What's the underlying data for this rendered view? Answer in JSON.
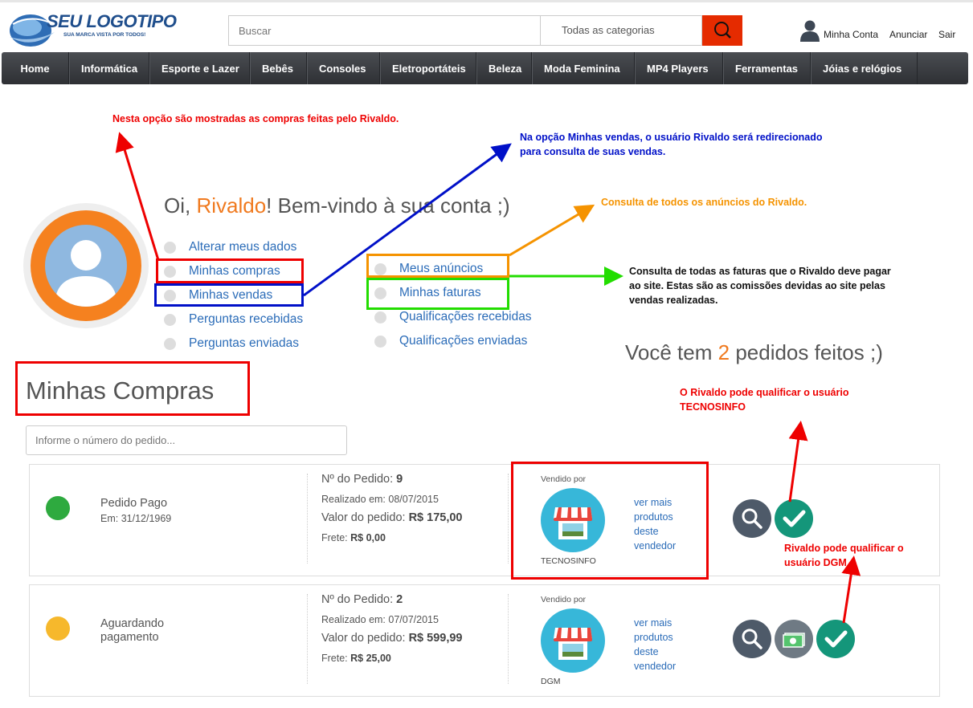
{
  "header": {
    "logo_title": "SEU LOGOTIPO",
    "logo_tagline": "SUA MARCA VISTA POR TODOS!",
    "search_placeholder": "Buscar",
    "category": "Todas as categorias",
    "account": "Minha Conta",
    "sell": "Anunciar",
    "logout": "Sair"
  },
  "nav": {
    "items": [
      "Home",
      "Informática",
      "Esporte e Lazer",
      "Bebês",
      "Consoles",
      "Eletroportáteis",
      "Beleza",
      "Moda Feminina",
      "MP4 Players",
      "Ferramentas",
      "Jóias e relógios"
    ]
  },
  "annotations": {
    "compras": "Nesta opção são mostradas as compras feitas pelo Rivaldo.",
    "vendas_1": "Na opção Minhas vendas, o usuário Rivaldo será redirecionado",
    "vendas_2": "para consulta de suas vendas.",
    "anuncios": "Consulta de todos os anúncios do Rivaldo.",
    "faturas_1": "Consulta de todas as faturas que o Rivaldo deve pagar",
    "faturas_2": "ao site. Estas são as comissões devidas ao site pelas",
    "faturas_3": "vendas realizadas.",
    "qualif_tecnosinfo_1": "O Rivaldo pode qualificar o usuário",
    "qualif_tecnosinfo_2": "TECNOSINFO",
    "qualif_dgm_1": "Rivaldo pode qualificar o",
    "qualif_dgm_2": "usuário DGM"
  },
  "welcome": {
    "prefix": "Oi, ",
    "name": "Rivaldo",
    "suffix": "! Bem-vindo à sua conta ;)"
  },
  "menu": {
    "left": [
      "Alterar meus dados",
      "Minhas compras",
      "Minhas vendas",
      "Perguntas recebidas",
      "Perguntas enviadas"
    ],
    "right": [
      "Meus anúncios",
      "Minhas faturas",
      "Qualificações recebidas",
      "Qualificações enviadas"
    ]
  },
  "orders_summary": {
    "prefix": "Você tem ",
    "count": "2",
    "suffix": " pedidos feitos ;)"
  },
  "section_title": "Minhas Compras",
  "order_search_placeholder": "Informe o número do pedido...",
  "labels": {
    "order_no": "Nº do Pedido: ",
    "date": "Realizado em: ",
    "value": "Valor do pedido: ",
    "freight": "Frete: ",
    "sold_by": "Vendido por",
    "more": "ver mais produtos deste vendedor"
  },
  "orders": [
    {
      "status_line1": "Pedido Pago",
      "status_line2": "Em: 31/12/1969",
      "status_color": "#2eaa3f",
      "number": "9",
      "date": "08/07/2015",
      "value": "R$ 175,00",
      "freight": "R$ 0,00",
      "seller": "TECNOSINFO"
    },
    {
      "status_line1": "Aguardando",
      "status_line2": "pagamento",
      "status_color": "#f6b82c",
      "number": "2",
      "date": "07/07/2015",
      "value": "R$ 599,99",
      "freight": "R$ 25,00",
      "seller": "DGM"
    }
  ]
}
